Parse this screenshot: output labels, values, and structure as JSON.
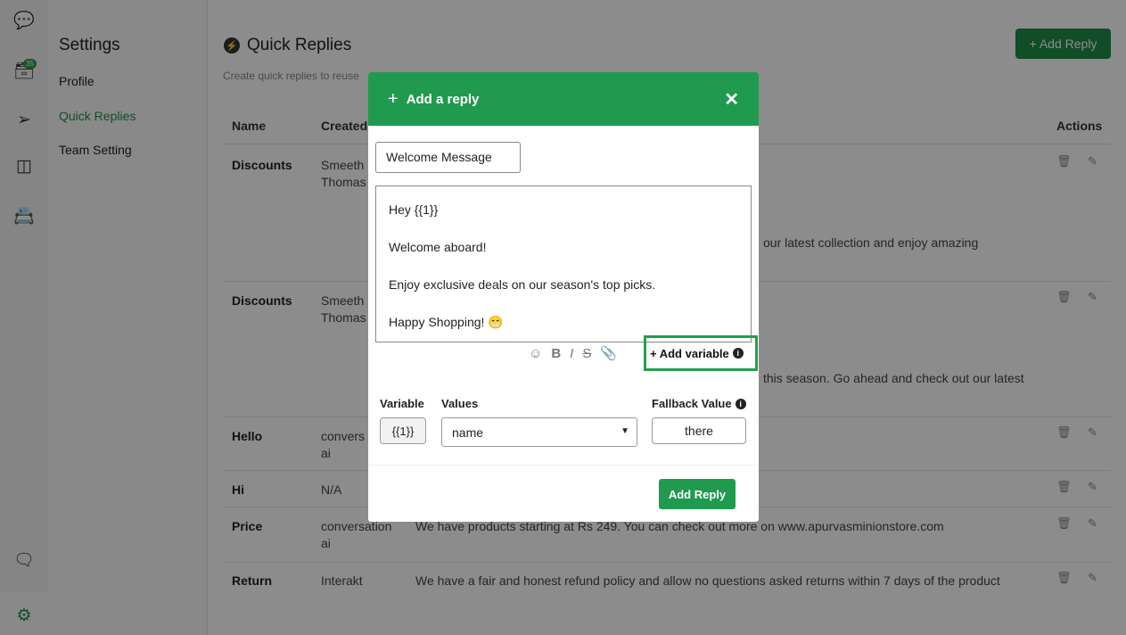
{
  "rail": {
    "inbox_badge": "35",
    "icons": [
      "logo-icon",
      "inbox-icon",
      "send-icon",
      "layout-icon",
      "contacts-icon",
      "chat-icon",
      "settings-icon"
    ]
  },
  "settings": {
    "title": "Settings",
    "items": [
      {
        "label": "Profile"
      },
      {
        "label": "Quick Replies",
        "active": true
      },
      {
        "label": "Team Setting"
      }
    ]
  },
  "page": {
    "title": "Quick Replies",
    "subtitle": "Create quick replies to reuse",
    "add_button": "+ Add Reply"
  },
  "table": {
    "headers": {
      "name": "Name",
      "created": "Created",
      "actions": "Actions"
    },
    "rows": [
      {
        "name": "Discounts",
        "created": "Smeeth\nThomas",
        "text": "our latest collection and enjoy amazing"
      },
      {
        "name": "Discounts",
        "created": "Smeeth\nThomas",
        "text": "this season. Go ahead and check out our latest"
      },
      {
        "name": "Hello",
        "created": "convers\nai",
        "text": ""
      },
      {
        "name": "Hi",
        "created": "N/A",
        "text": ""
      },
      {
        "name": "Price",
        "created": "conversation\nai",
        "text": "We have products starting at Rs 249. You can check out more on www.apurvasminionstore.com"
      },
      {
        "name": "Return",
        "created": "Interakt",
        "text": "We have a fair and honest refund policy and allow no questions asked returns within 7 days of the product"
      }
    ]
  },
  "modal": {
    "title": "Add a reply",
    "name_value": "Welcome Message",
    "body_lines": [
      "Hey {{1}}",
      "Welcome aboard!",
      "Enjoy exclusive deals on our season's top picks.",
      "Happy Shopping! 😁"
    ],
    "add_variable": "+ Add variable",
    "labels": {
      "variable": "Variable",
      "values": "Values",
      "fallback": "Fallback Value"
    },
    "variable": "{{1}}",
    "value_selected": "name",
    "fallback_value": "there",
    "submit": "Add Reply"
  },
  "colors": {
    "brand": "#1f9a4f",
    "highlight": "#22a04c"
  }
}
